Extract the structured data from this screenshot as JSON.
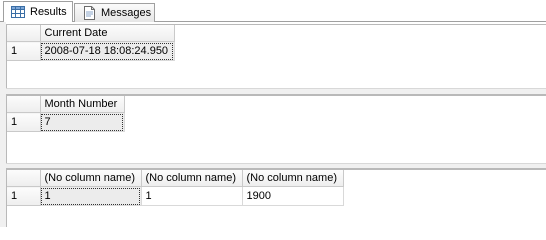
{
  "tabs": {
    "results_label": "Results",
    "messages_label": "Messages"
  },
  "results": [
    {
      "columns": [
        "Current Date"
      ],
      "rows": [
        {
          "row_number": "1",
          "cells": [
            "2008-07-18 18:08:24.950"
          ]
        }
      ]
    },
    {
      "columns": [
        "Month Number"
      ],
      "rows": [
        {
          "row_number": "1",
          "cells": [
            "7"
          ]
        }
      ]
    },
    {
      "columns": [
        "(No column name)",
        "(No column name)",
        "(No column name)"
      ],
      "rows": [
        {
          "row_number": "1",
          "cells": [
            "1",
            "1",
            "1900"
          ]
        }
      ]
    }
  ],
  "colors": {
    "grid_header_bg": "#eeeeee",
    "grid_line": "#d9d9d9",
    "selected_cell_bg": "#ececec"
  },
  "icons": {
    "results_tab": "grid-icon",
    "messages_tab": "document-icon"
  }
}
